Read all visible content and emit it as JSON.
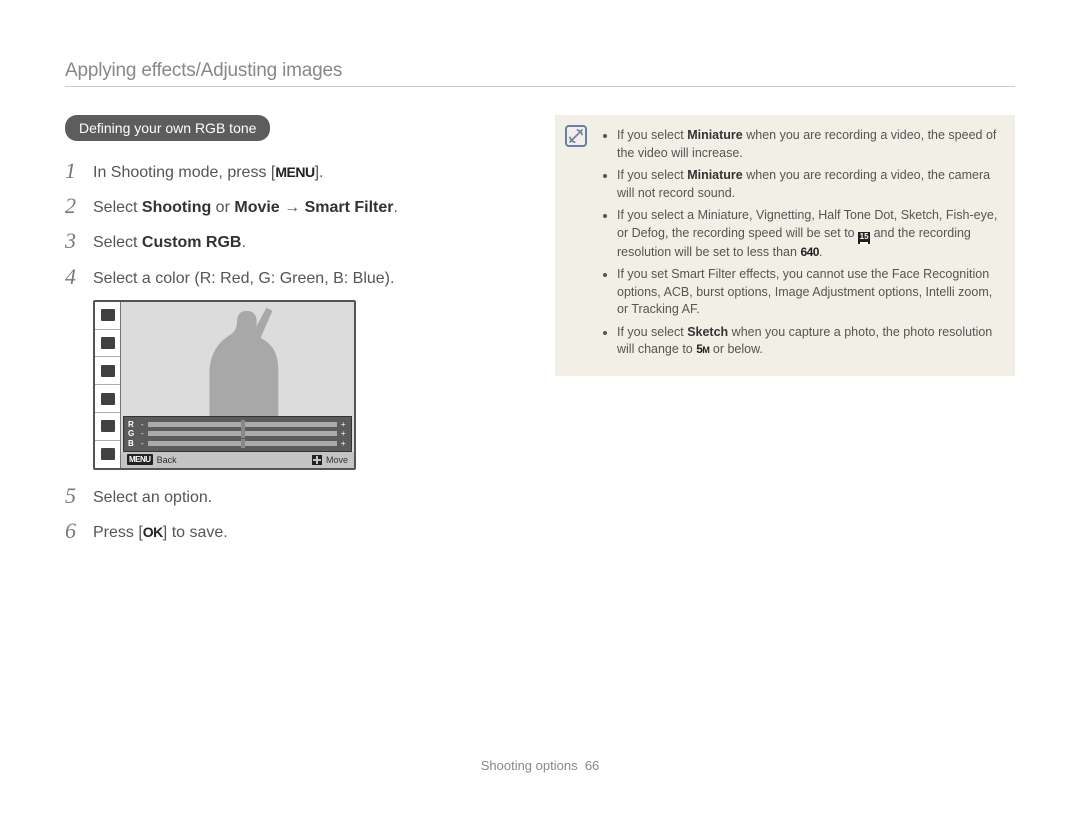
{
  "header": "Applying effects/Adjusting images",
  "pill": "Defining your own RGB tone",
  "steps": [
    {
      "n": "1",
      "pre": "In Shooting mode, press [",
      "btn": "MENU",
      "post": "]."
    },
    {
      "n": "2",
      "txt_a": "Select ",
      "b1": "Shooting",
      "txt_b": " or ",
      "b2": "Movie",
      "arrow": " → ",
      "b3": "Smart Filter",
      "txt_c": "."
    },
    {
      "n": "3",
      "txt_a": "Select ",
      "b1": "Custom RGB",
      "txt_c": "."
    },
    {
      "n": "4",
      "plain": "Select a color (R: Red, G: Green, B: Blue)."
    },
    {
      "n": "5",
      "plain": "Select an option."
    },
    {
      "n": "6",
      "pre": "Press [",
      "btn": "OK",
      "post": "] to save."
    }
  ],
  "lcd": {
    "rows": [
      "R",
      "G",
      "B"
    ],
    "back": "Back",
    "move": "Move",
    "menu_glyph": "MENU"
  },
  "info": [
    {
      "parts": [
        {
          "t": "If you select "
        },
        {
          "b": "Miniature"
        },
        {
          "t": " when you are recording a video, the speed of the video will increase."
        }
      ]
    },
    {
      "parts": [
        {
          "t": "If you select "
        },
        {
          "b": "Miniature"
        },
        {
          "t": " when you are recording a video, the camera will not record sound."
        }
      ]
    },
    {
      "parts": [
        {
          "t": "If you select a Miniature, Vignetting, Half Tone Dot, Sketch, Fish-eye, or Defog, the recording speed will be set to "
        },
        {
          "g": "15"
        },
        {
          "t": " and the recording resolution will be set to less than "
        },
        {
          "g": "640"
        },
        {
          "t": "."
        }
      ]
    },
    {
      "parts": [
        {
          "t": "If you set Smart Filter effects, you cannot use the Face Recognition options, ACB, burst options, Image Adjustment options, Intelli zoom, or Tracking AF."
        }
      ]
    },
    {
      "parts": [
        {
          "t": "If you select "
        },
        {
          "b": "Sketch"
        },
        {
          "t": " when you capture a photo, the photo resolution will change to "
        },
        {
          "g": "5M"
        },
        {
          "t": " or below."
        }
      ]
    }
  ],
  "footer": {
    "label": "Shooting options",
    "page": "66"
  }
}
